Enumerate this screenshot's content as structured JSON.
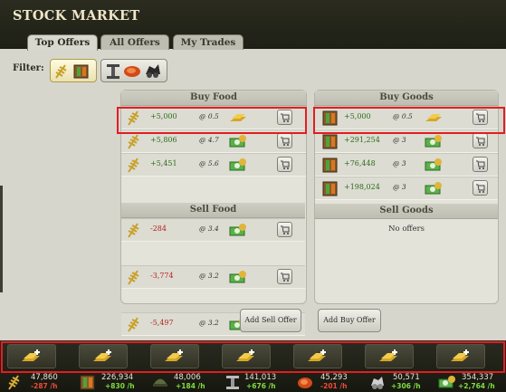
{
  "title": "STOCK MARKET",
  "tabs": [
    {
      "label": "Top Offers"
    },
    {
      "label": "All Offers"
    },
    {
      "label": "My Trades"
    }
  ],
  "filter": {
    "label": "Filter:"
  },
  "buy_food": {
    "title": "Buy Food",
    "rows": [
      {
        "amount": "+5,000",
        "price": "@ 0.5"
      },
      {
        "amount": "+5,806",
        "price": "@ 4.7"
      },
      {
        "amount": "+5,451",
        "price": "@ 5.6"
      }
    ]
  },
  "sell_food": {
    "title": "Sell Food",
    "rows": [
      {
        "amount": "-284",
        "price": "@ 3.4"
      },
      {
        "amount": "-3,774",
        "price": "@ 3.2"
      },
      {
        "amount": "-5,497",
        "price": "@ 3.2"
      }
    ]
  },
  "buy_goods": {
    "title": "Buy Goods",
    "rows": [
      {
        "amount": "+5,000",
        "price": "@ 0.5"
      },
      {
        "amount": "+291,254",
        "price": "@ 3"
      },
      {
        "amount": "+76,448",
        "price": "@ 3"
      },
      {
        "amount": "+198,024",
        "price": "@ 3"
      }
    ]
  },
  "sell_goods": {
    "title": "Sell Goods",
    "empty_text": "No offers"
  },
  "buttons": {
    "add_sell": "Add Sell Offer",
    "add_buy": "Add Buy Offer"
  },
  "resources": [
    {
      "icon": "wheat-icon",
      "value": "47,860",
      "rate": "-287 /h",
      "rate_sign": "neg"
    },
    {
      "icon": "goods-crate-icon",
      "value": "226,934",
      "rate": "+830 /h",
      "rate_sign": "pos"
    },
    {
      "icon": "soldier-helmet-icon",
      "value": "48,006",
      "rate": "+184 /h",
      "rate_sign": "pos"
    },
    {
      "icon": "iron-beam-icon",
      "value": "141,013",
      "rate": "+676 /h",
      "rate_sign": "pos"
    },
    {
      "icon": "meat-icon",
      "value": "45,293",
      "rate": "-201 /h",
      "rate_sign": "neg"
    },
    {
      "icon": "coal-ore-icon",
      "value": "50,571",
      "rate": "+306 /h",
      "rate_sign": "pos"
    },
    {
      "icon": "money-icon",
      "value": "354,337",
      "rate": "+2,764 /h",
      "rate_sign": "pos"
    }
  ],
  "colors": {
    "positive": "#2f6d1a",
    "negative": "#b3261e",
    "highlight": "#e21d22"
  }
}
